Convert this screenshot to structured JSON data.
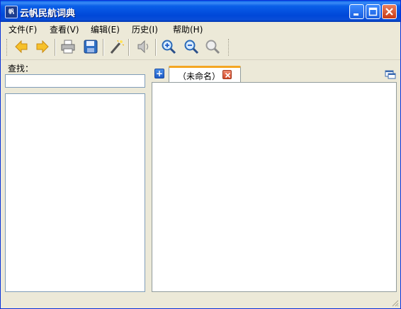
{
  "window": {
    "title": "云帆民航词典",
    "icon_name": "app-icon",
    "icon_text": "帆"
  },
  "menu": {
    "items": [
      {
        "label": "文件(F)"
      },
      {
        "label": "查看(V)"
      },
      {
        "label": "编辑(E)"
      },
      {
        "label": "历史(I)"
      },
      {
        "label": "帮助(H)"
      }
    ]
  },
  "toolbar": {
    "buttons": [
      {
        "name": "back-button",
        "icon": "arrow-left-icon"
      },
      {
        "name": "forward-button",
        "icon": "arrow-right-icon"
      },
      {
        "name": "print-button",
        "icon": "printer-icon"
      },
      {
        "name": "save-button",
        "icon": "floppy-disk-icon"
      },
      {
        "name": "magic-wand-button",
        "icon": "magic-wand-icon"
      },
      {
        "name": "speak-button",
        "icon": "speaker-icon"
      },
      {
        "name": "zoom-in-button",
        "icon": "zoom-in-icon"
      },
      {
        "name": "zoom-out-button",
        "icon": "zoom-out-icon"
      },
      {
        "name": "zoom-reset-button",
        "icon": "zoom-icon"
      }
    ]
  },
  "search": {
    "label": "查找：",
    "value": ""
  },
  "tabs": {
    "new_tab": "+",
    "items": [
      {
        "label": "（未命名）",
        "active": true
      }
    ]
  },
  "colors": {
    "titlebar": "#0a5fe8",
    "tab_accent": "#f4a623",
    "border": "#7f9db9"
  }
}
